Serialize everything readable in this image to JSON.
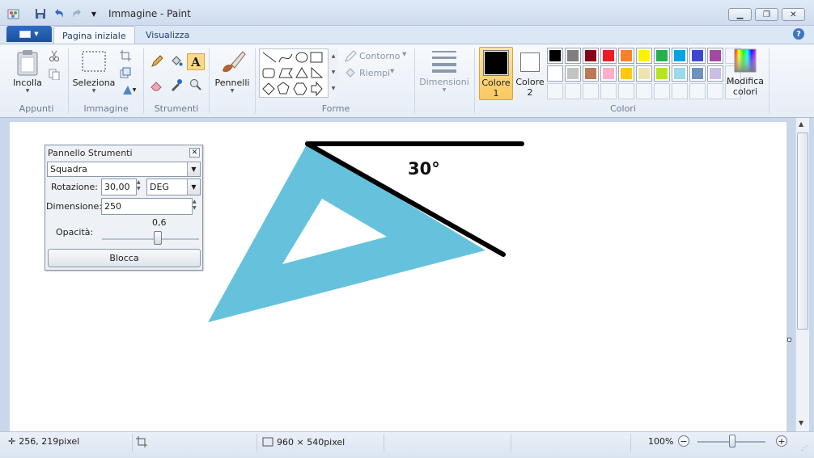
{
  "window": {
    "title": "Immagine - Paint"
  },
  "tabs": {
    "home": "Pagina iniziale",
    "view": "Visualizza"
  },
  "ribbon": {
    "paste": "Incolla",
    "select": "Seleziona",
    "brushes": "Pennelli",
    "outline": "Contorno",
    "fill": "Riempi",
    "size": "Dimensioni",
    "color1": "Colore 1",
    "color2": "Colore 2",
    "edit_colors": "Modifica colori",
    "groups": {
      "clipboard": "Appunti",
      "image": "Immagine",
      "tools": "Strumenti",
      "shapes": "Forme",
      "colors": "Colori"
    }
  },
  "colors": {
    "color1": "#000000",
    "color2": "#ffffff",
    "palette_row1": [
      "#000000",
      "#7f7f7f",
      "#880015",
      "#ed1c24",
      "#ff7f27",
      "#fff200",
      "#22b14c",
      "#00a2e8",
      "#3f48cc",
      "#a349a4"
    ],
    "palette_row2": [
      "#ffffff",
      "#c3c3c3",
      "#b97a57",
      "#ffaec9",
      "#ffc90e",
      "#efe4b0",
      "#b5e61d",
      "#99d9ea",
      "#7092be",
      "#c8bfe7"
    ]
  },
  "canvas": {
    "angle_label": "30°",
    "triangle_color": "#66c2dc"
  },
  "panel": {
    "title": "Pannello Strumenti",
    "tool": "Squadra",
    "rotation_label": "Rotazione:",
    "rotation_value": "30,00",
    "unit": "DEG",
    "size_label": "Dimensione:",
    "size_value": "250",
    "opacity_value_label": "0,6",
    "opacity_label": "Opacità:",
    "opacity": 0.6,
    "lock_button": "Blocca"
  },
  "status": {
    "cursor_position": "256, 219pixel",
    "image_size": "960 × 540pixel",
    "zoom": "100%"
  }
}
